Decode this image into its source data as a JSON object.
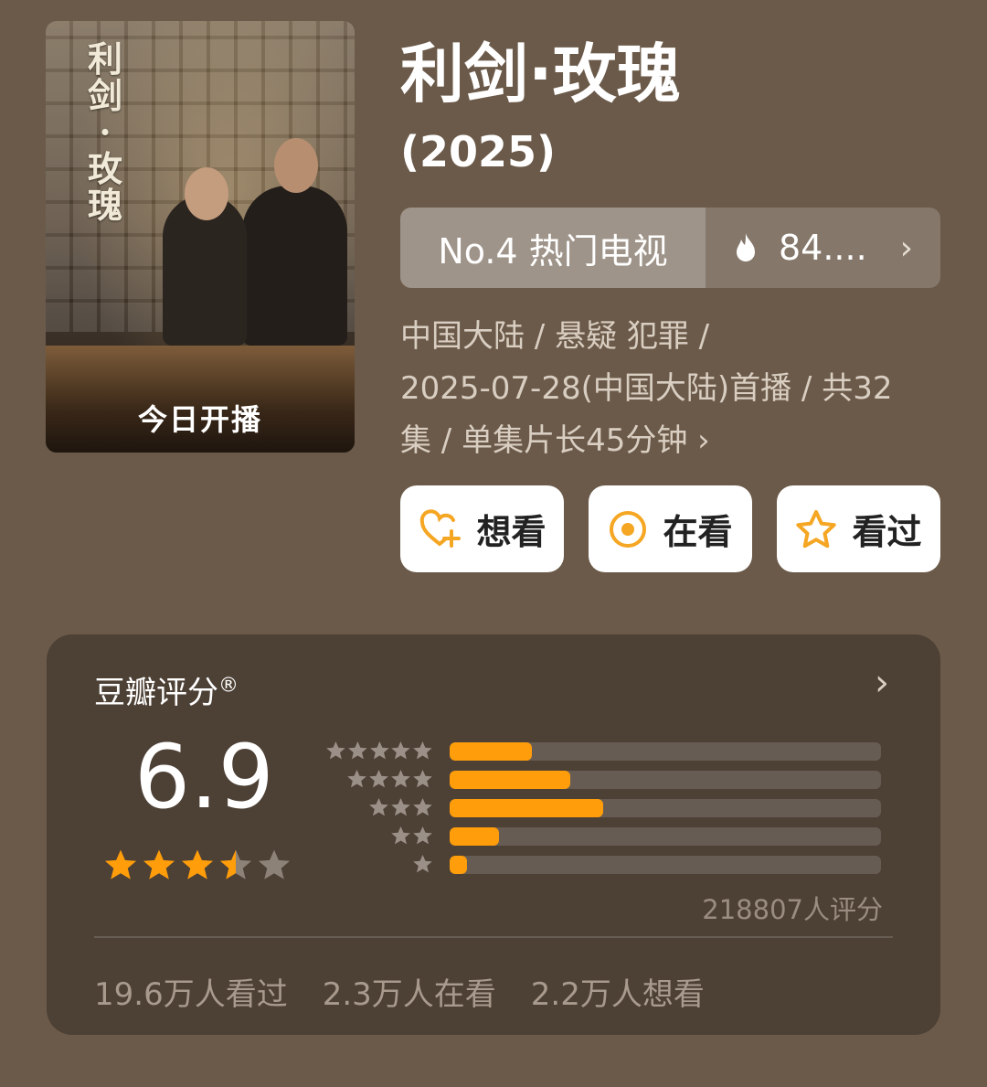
{
  "poster": {
    "title_art": "利剑·玫瑰",
    "caption": "今日开播"
  },
  "title": "利剑·玫瑰",
  "year": "(2025)",
  "rank": {
    "label": "No.4 热门电视",
    "heat": "84....",
    "heat_icon": "flame-icon",
    "chevron_icon": "chevron-right-icon"
  },
  "meta": {
    "line1": "中国大陆 / 悬疑 犯罪 /",
    "line2": "2025-07-28(中国大陆)首播 / 共32",
    "line3": "集 / 单集片长45分钟",
    "chevron": "›"
  },
  "actions": {
    "want_label": "想看",
    "watching_label": "在看",
    "watched_label": "看过",
    "want_icon": "heart-plus-icon",
    "watching_icon": "target-icon",
    "watched_icon": "star-outline-icon"
  },
  "rating": {
    "label": "豆瓣评分",
    "registered": "®",
    "chevron": "›",
    "score": "6.9",
    "stars_value": 3.5,
    "distribution": [
      {
        "stars": 5,
        "fraction": 0.19
      },
      {
        "stars": 4,
        "fraction": 0.28
      },
      {
        "stars": 3,
        "fraction": 0.355
      },
      {
        "stars": 2,
        "fraction": 0.115
      },
      {
        "stars": 1,
        "fraction": 0.04
      }
    ],
    "count_text": "218807人评分",
    "stats": {
      "watched": "19.6万人看过",
      "watching": "2.3万人在看",
      "want": "2.2万人想看"
    }
  },
  "colors": {
    "background": "#6b5a49",
    "card": "#4d4035",
    "accent": "#ff9d0a",
    "star_gray": "#8c8278"
  }
}
